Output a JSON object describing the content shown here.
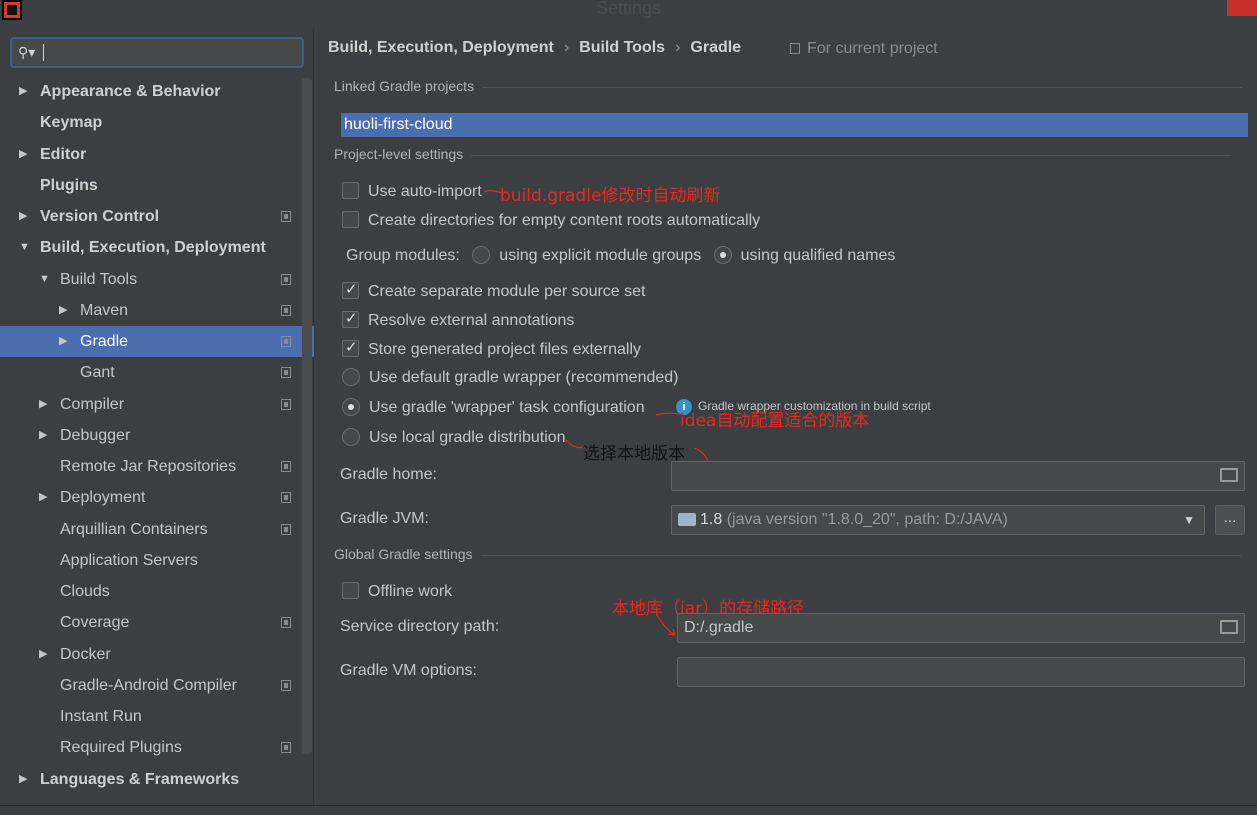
{
  "window": {
    "title": "Settings"
  },
  "search": {
    "value": ""
  },
  "sidebar": {
    "items": [
      {
        "label": "Appearance & Behavior",
        "expander": "right",
        "copy": false
      },
      {
        "label": "Keymap",
        "expander": "",
        "copy": false
      },
      {
        "label": "Editor",
        "expander": "right",
        "copy": false
      },
      {
        "label": "Plugins",
        "expander": "",
        "copy": false
      },
      {
        "label": "Version Control",
        "expander": "right",
        "copy": true
      },
      {
        "label": "Build, Execution, Deployment",
        "expander": "down",
        "copy": false
      },
      {
        "label": "Build Tools",
        "expander": "down",
        "copy": true
      },
      {
        "label": "Maven",
        "expander": "right",
        "copy": true
      },
      {
        "label": "Gradle",
        "expander": "right",
        "copy": true
      },
      {
        "label": "Gant",
        "expander": "",
        "copy": true
      },
      {
        "label": "Compiler",
        "expander": "right",
        "copy": true
      },
      {
        "label": "Debugger",
        "expander": "right",
        "copy": false
      },
      {
        "label": "Remote Jar Repositories",
        "expander": "",
        "copy": true
      },
      {
        "label": "Deployment",
        "expander": "right",
        "copy": true
      },
      {
        "label": "Arquillian Containers",
        "expander": "",
        "copy": true
      },
      {
        "label": "Application Servers",
        "expander": "",
        "copy": false
      },
      {
        "label": "Clouds",
        "expander": "",
        "copy": false
      },
      {
        "label": "Coverage",
        "expander": "",
        "copy": true
      },
      {
        "label": "Docker",
        "expander": "right",
        "copy": false
      },
      {
        "label": "Gradle-Android Compiler",
        "expander": "",
        "copy": true
      },
      {
        "label": "Instant Run",
        "expander": "",
        "copy": false
      },
      {
        "label": "Required Plugins",
        "expander": "",
        "copy": true
      },
      {
        "label": "Languages & Frameworks",
        "expander": "right",
        "copy": false
      }
    ]
  },
  "breadcrumb": [
    "Build, Execution, Deployment",
    "Build Tools",
    "Gradle"
  ],
  "for_current_project": "For current project",
  "sections": {
    "linked": "Linked Gradle projects",
    "project_level": "Project-level settings",
    "global": "Global Gradle settings"
  },
  "linked_project": "huoli-first-cloud",
  "options": {
    "auto_import": "Use auto-import",
    "create_dirs": "Create directories for empty content roots automatically",
    "group_modules_label": "Group modules:",
    "group_explicit": "using explicit module groups",
    "group_qualified": "using qualified names",
    "separate_module": "Create separate module per source set",
    "resolve_annotations": "Resolve external annotations",
    "store_generated": "Store generated project files externally",
    "default_wrapper": "Use default gradle wrapper (recommended)",
    "wrapper_task": "Use gradle 'wrapper' task configuration",
    "local_distribution": "Use local gradle distribution",
    "wrapper_hint": "Gradle wrapper customization in build script",
    "offline_work": "Offline work"
  },
  "fields": {
    "gradle_home_label": "Gradle home:",
    "gradle_home_value": "",
    "gradle_jvm_label": "Gradle JVM:",
    "gradle_jvm_version": "1.8",
    "gradle_jvm_detail": "(java version \"1.8.0_20\", path: D:/JAVA)",
    "ellipsis": "...",
    "service_dir_label": "Service directory path:",
    "service_dir_value": "D:/.gradle",
    "vm_options_label": "Gradle VM options:",
    "vm_options_value": ""
  },
  "annotations": {
    "auto_import_note": "build.gradle修改时自动刷新",
    "wrapper_note": "idea自动配置适合的版本",
    "local_note": "选择本地版本",
    "service_note": "本地库（jar）的存储路径"
  },
  "colors": {
    "selection": "#4b6eaf",
    "annotation_red": "#e8281f",
    "background": "#3c3f41"
  }
}
